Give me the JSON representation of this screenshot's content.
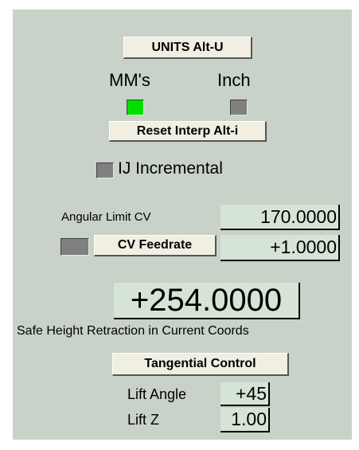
{
  "units": {
    "button_label": "UNITS Alt-U",
    "mm_label": "MM's",
    "inch_label": "Inch",
    "mm_active": true,
    "inch_active": false
  },
  "reset_interp": {
    "button_label": "Reset Interp Alt-i"
  },
  "ij_incremental": {
    "label": "IJ Incremental",
    "active": false
  },
  "angular_limit": {
    "label": "Angular Limit CV",
    "value": "170.0000"
  },
  "cv_feedrate": {
    "button_label": "CV Feedrate",
    "value": "+1.0000",
    "active": false
  },
  "safe_height": {
    "value": "+254.0000",
    "label": "Safe Height Retraction in Current Coords"
  },
  "tangential": {
    "button_label": "Tangential Control",
    "lift_angle_label": "Lift Angle",
    "lift_angle_value": "+45",
    "lift_z_label": "Lift Z",
    "lift_z_value": "1.00"
  },
  "colors": {
    "panel_bg": "#c8d2c8",
    "button_bg": "#f1efe2",
    "led_on": "#00e000",
    "led_off": "#808080",
    "dro_bg": "#d6e4d6"
  }
}
